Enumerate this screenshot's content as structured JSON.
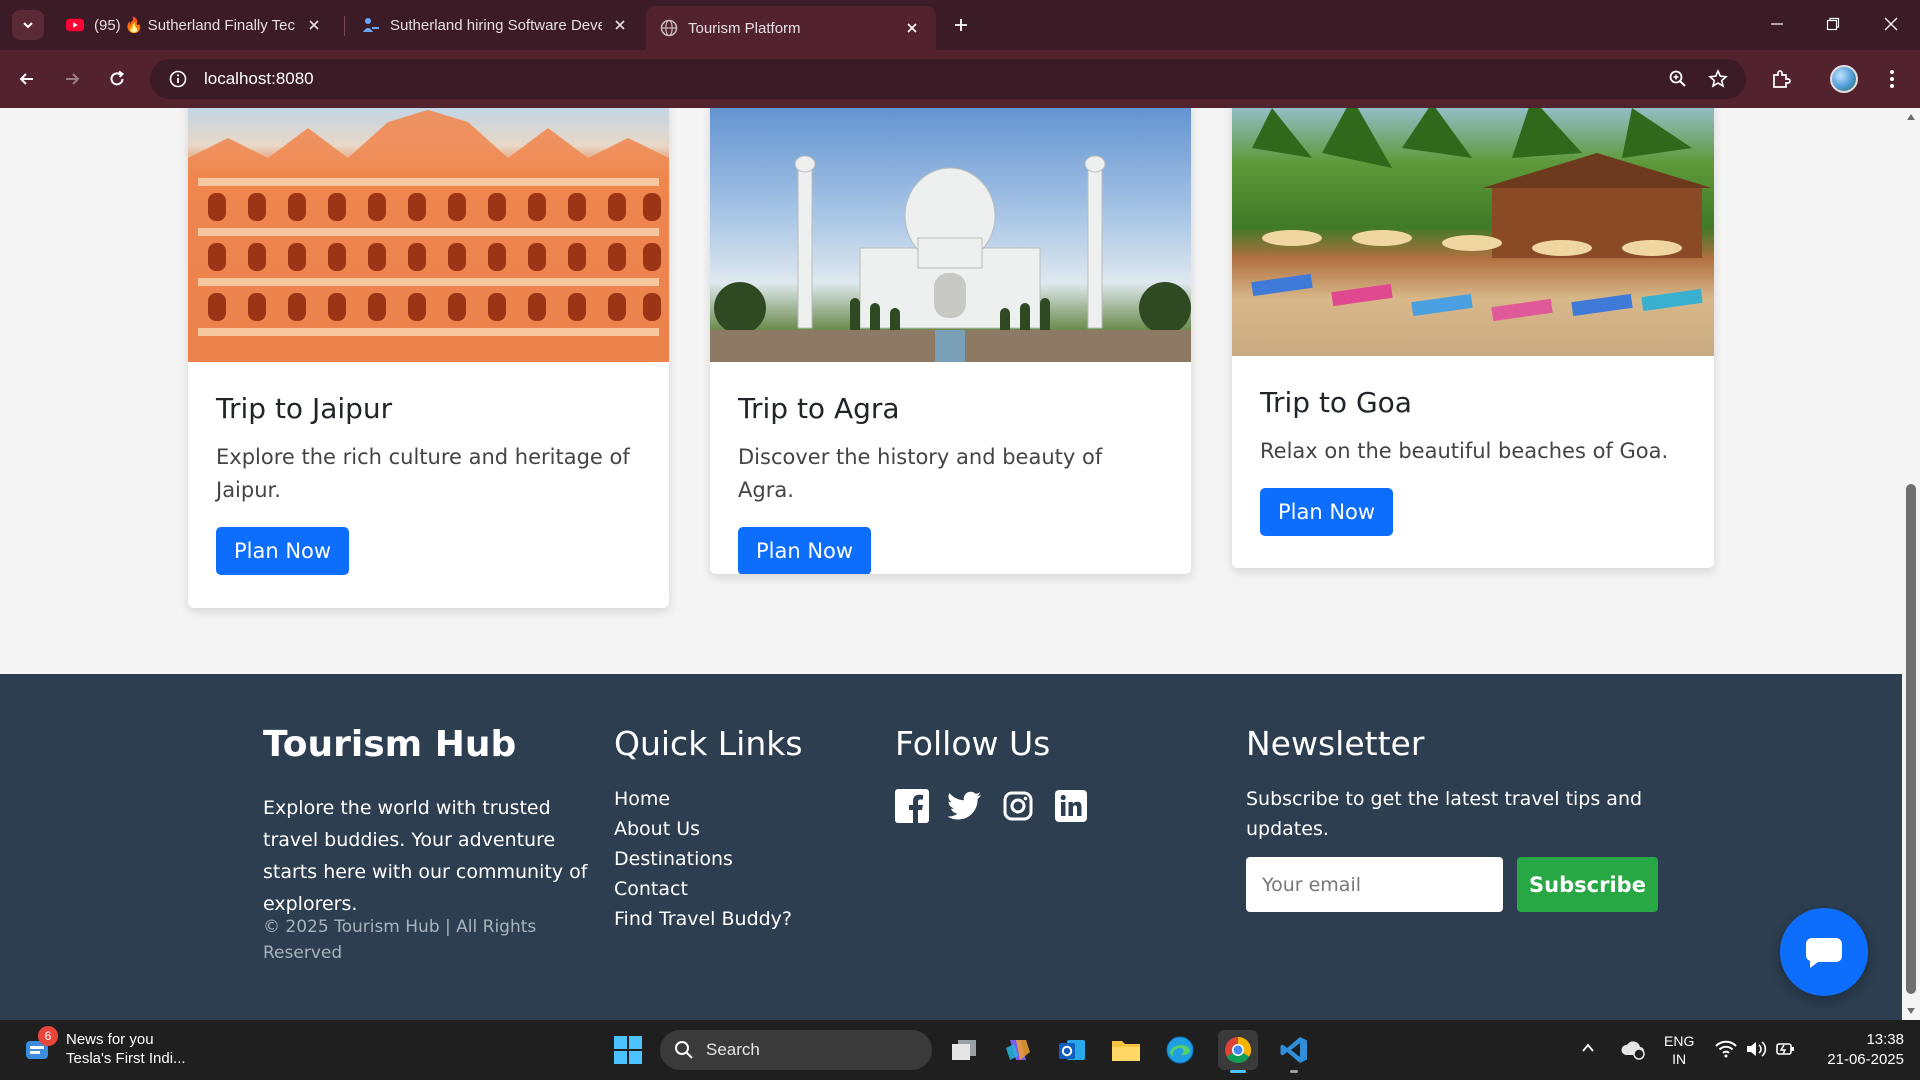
{
  "browser": {
    "tabs": [
      {
        "title": "(95) 🔥 Sutherland Finally Tech Hiring",
        "favicon": "youtube-icon",
        "active": false
      },
      {
        "title": "Sutherland hiring Software Developer",
        "favicon": "job-site-icon",
        "active": false
      },
      {
        "title": "Tourism Platform",
        "favicon": "globe-icon",
        "active": true
      }
    ],
    "url": "localhost:8080"
  },
  "cards": [
    {
      "title": "Trip to Jaipur",
      "desc": "Explore the rich culture and heritage of Jaipur.",
      "button": "Plan Now",
      "image": "hawa-mahal-photo"
    },
    {
      "title": "Trip to Agra",
      "desc": "Discover the history and beauty of Agra.",
      "button": "Plan Now",
      "image": "taj-mahal-photo"
    },
    {
      "title": "Trip to Goa",
      "desc": "Relax on the beautiful beaches of Goa.",
      "button": "Plan Now",
      "image": "goa-beach-photo"
    }
  ],
  "footer": {
    "brand": "Tourism Hub",
    "about": "Explore the world with trusted travel buddies. Your adventure starts here with our community of explorers.",
    "copyright": "© 2025 Tourism Hub | All Rights Reserved",
    "quick_links_title": "Quick Links",
    "links": [
      "Home",
      "About Us",
      "Destinations",
      "Contact",
      "Find Travel Buddy?"
    ],
    "follow_title": "Follow Us",
    "socials": [
      "facebook-icon",
      "twitter-icon",
      "instagram-icon",
      "linkedin-icon"
    ],
    "newsletter_title": "Newsletter",
    "newsletter_text": "Subscribe to get the latest travel tips and updates.",
    "email_placeholder": "Your email",
    "subscribe_label": "Subscribe"
  },
  "taskbar": {
    "news_badge": "6",
    "news_title": "News for you",
    "news_subtitle": "Tesla's First Indi...",
    "search_label": "Search",
    "lang_top": "ENG",
    "lang_bottom": "IN",
    "time": "13:38",
    "date": "21-06-2025"
  },
  "colors": {
    "browser_frame": "#3b1b25",
    "primary_button": "#0d6efd",
    "success_button": "#28a745",
    "footer_bg": "#2c3e50"
  }
}
